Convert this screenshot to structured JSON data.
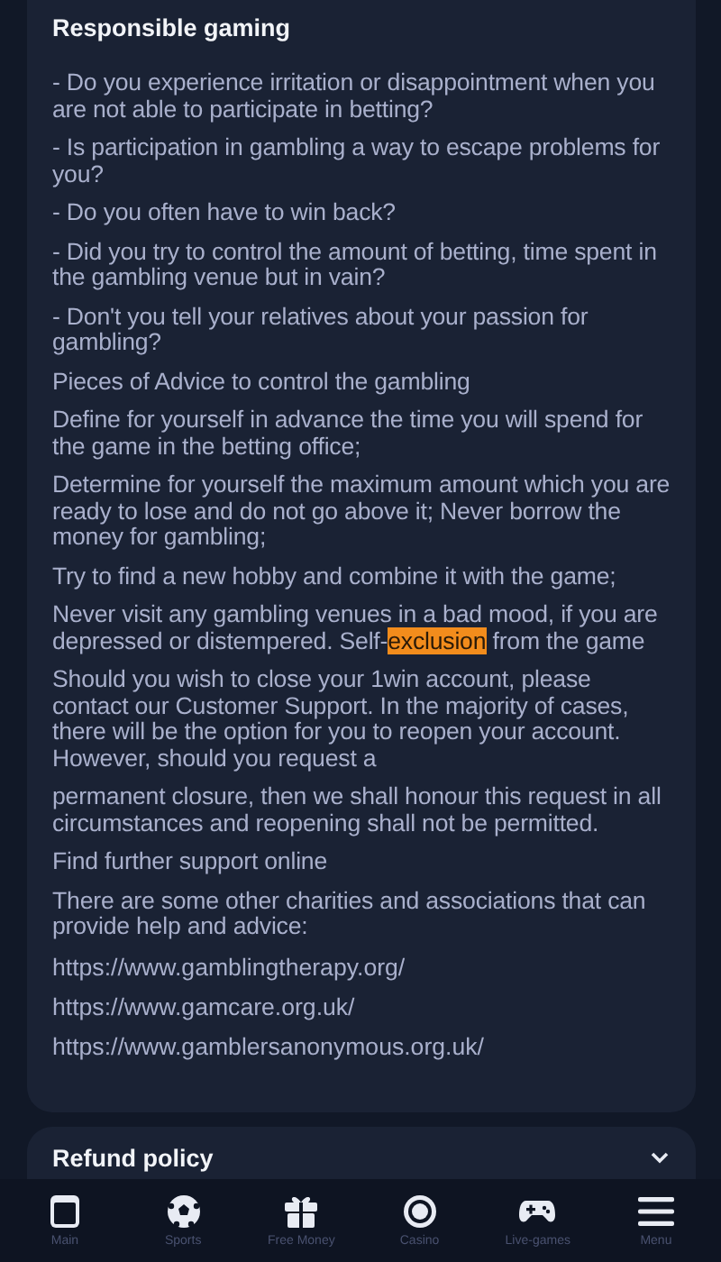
{
  "section": {
    "title": "Responsible gaming",
    "paragraphs": [
      [
        {
          "text": "- Do you experience irritation or disappointment when you are not able to participate in betting?",
          "highlighted": false
        }
      ],
      [
        {
          "text": "- Is participation in gambling a way to escape problems for you?",
          "highlighted": false
        }
      ],
      [
        {
          "text": "- Do you often have to win back?",
          "highlighted": false
        }
      ],
      [
        {
          "text": "- Did you try to control the amount of betting, time spent in the gambling venue but in vain?",
          "highlighted": false
        }
      ],
      [
        {
          "text": "- Don't you tell your relatives about your passion for gambling?",
          "highlighted": false
        }
      ],
      [
        {
          "text": "Pieces of Advice to control the gambling",
          "highlighted": false
        }
      ],
      [
        {
          "text": "Define for yourself in advance the time you will spend for the game in the betting office;",
          "highlighted": false
        }
      ],
      [
        {
          "text": "Determine for yourself the maximum amount which you are ready to lose and do not go above it; Never borrow the money for gambling;",
          "highlighted": false
        }
      ],
      [
        {
          "text": "Try to find a new hobby and combine it with the game;",
          "highlighted": false
        }
      ],
      [
        {
          "text": "Never visit any gambling venues in a bad mood, if you are depressed or distempered. Self-",
          "highlighted": false
        },
        {
          "text": "exclusion",
          "highlighted": true
        },
        {
          "text": " from the game",
          "highlighted": false
        }
      ],
      [
        {
          "text": "Should you wish to close your 1win account, please contact our Customer Support. In the majority of cases, there will be the option for you to reopen your account. However, should you request a",
          "highlighted": false
        }
      ],
      [
        {
          "text": "permanent closure, then we shall honour this request in all circumstances and reopening shall not be permitted.",
          "highlighted": false
        }
      ],
      [
        {
          "text": "Find further support online",
          "highlighted": false
        }
      ],
      [
        {
          "text": "There are some other charities and associations that can provide help and advice:",
          "highlighted": false
        }
      ]
    ],
    "links": [
      "https://www.gamblingtherapy.org/",
      "https://www.gamcare.org.uk/",
      "https://www.gamblersanonymous.org.uk/"
    ]
  },
  "accordion": {
    "title": "Refund policy",
    "expanded": false
  },
  "nav": [
    {
      "label": "Main",
      "kind": "main"
    },
    {
      "label": "Sports",
      "kind": "sports"
    },
    {
      "label": "Free Money",
      "kind": "gift"
    },
    {
      "label": "Casino",
      "kind": "casino"
    },
    {
      "label": "Live-games",
      "kind": "gamepad"
    },
    {
      "label": "Menu",
      "kind": "menu"
    }
  ]
}
